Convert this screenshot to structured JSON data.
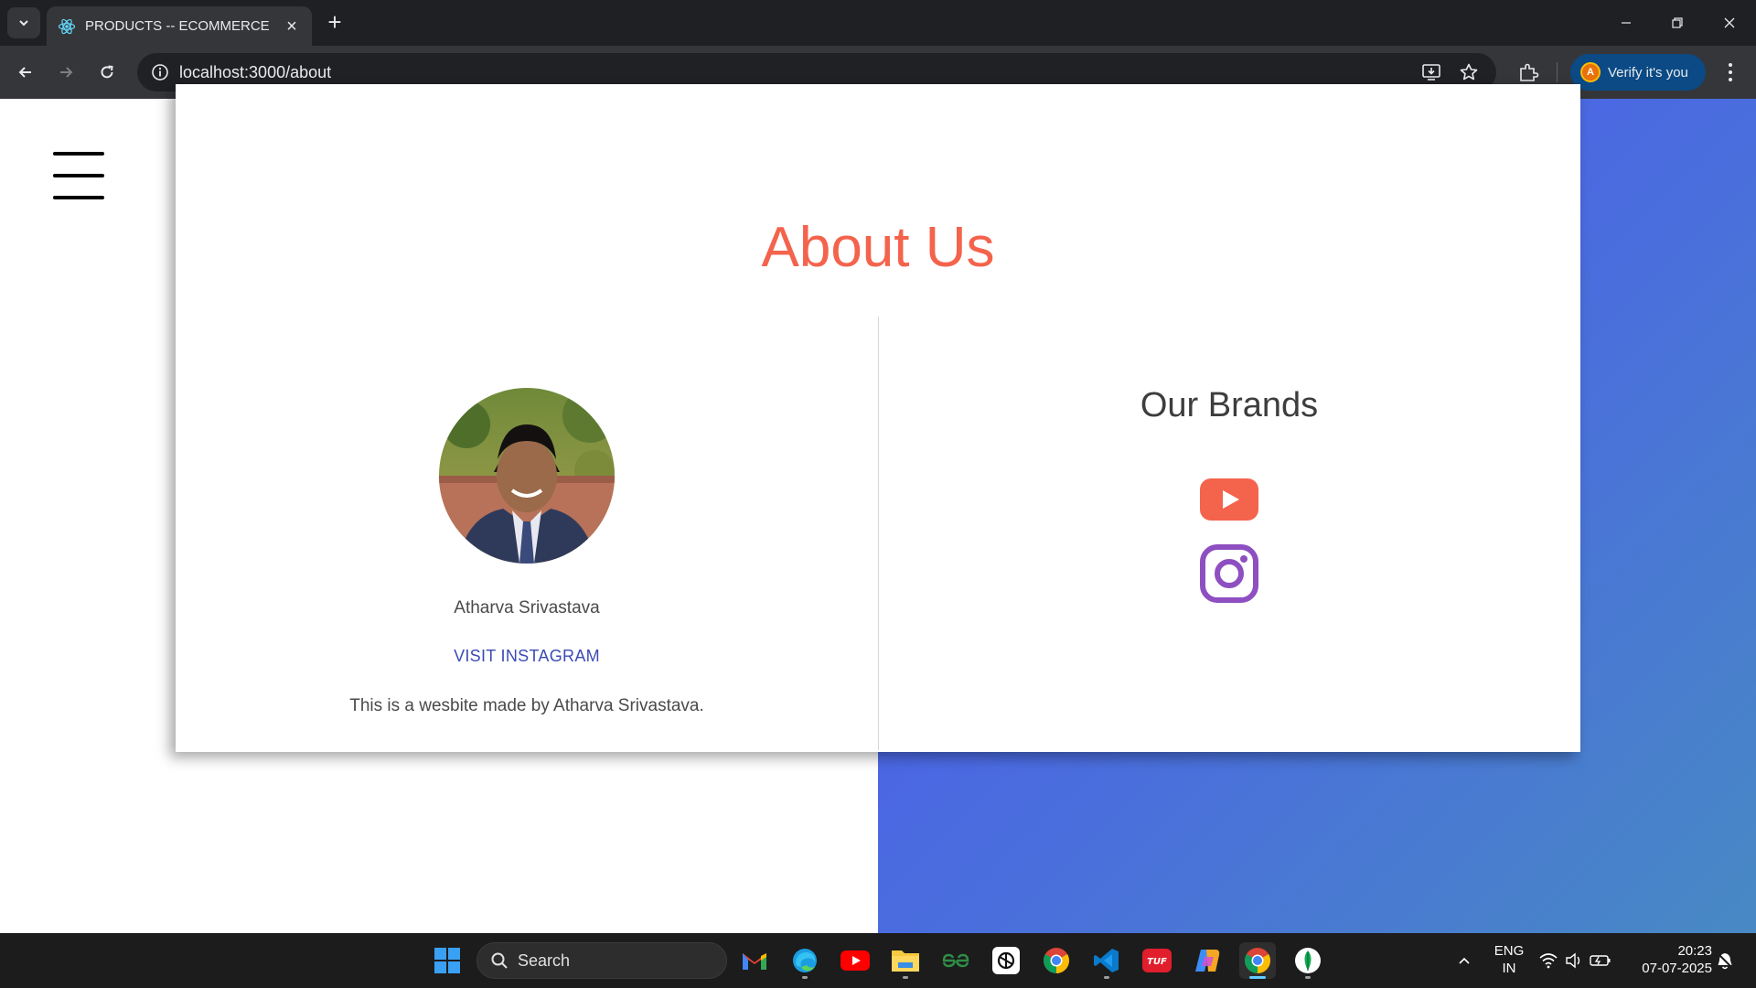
{
  "browser": {
    "tab_title": "PRODUCTS -- ECOMMERCE",
    "url": "localhost:3000/about",
    "verify_label": "Verify it's you",
    "verify_avatar_letter": "A"
  },
  "page": {
    "title": "About Us",
    "person_name": "Atharva Srivastava",
    "instagram_link": "VISIT INSTAGRAM",
    "description": "This is a wesbite made by Atharva Srivastava.",
    "brands_title": "Our Brands",
    "brand_icons": [
      "youtube-icon",
      "instagram-icon"
    ]
  },
  "taskbar": {
    "search_label": "Search",
    "apps": [
      "windows-start",
      "search",
      "gmail",
      "edge",
      "youtube",
      "file-explorer",
      "geeksforgeeks",
      "chatgpt",
      "chrome",
      "vscode",
      "tuf",
      "copilot",
      "chrome-active",
      "mongodb-compass"
    ],
    "language_line1": "ENG",
    "language_line2": "IN",
    "time": "20:23",
    "date": "07-07-2025"
  },
  "colors": {
    "title": "#f4634c",
    "link": "#3b4bb5",
    "youtube": "#f4634c",
    "instagram": "#8e4fc1",
    "gradient_start": "#4d55f5",
    "gradient_end": "#4889c4"
  }
}
